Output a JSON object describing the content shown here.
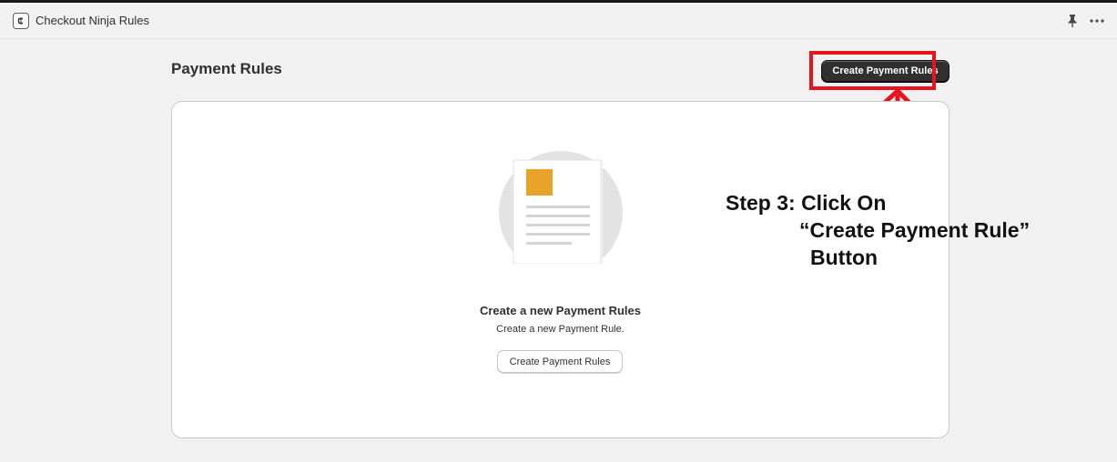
{
  "window": {
    "title": "Checkout Ninja Rules",
    "app_icon": "checkout-ninja-logo",
    "actions": [
      "pin-icon",
      "more-icon"
    ]
  },
  "page": {
    "title": "Payment Rules",
    "primary_action_label": "Create Payment Rules"
  },
  "empty_state": {
    "illustration": "document-icon",
    "heading": "Create a new Payment Rules",
    "description": "Create a new Payment Rule.",
    "button_label": "Create Payment Rules"
  },
  "annotation": {
    "line1": "Step 3: Click On",
    "line2": "“Create Payment Rule”",
    "line3": "Button",
    "color": "#e8141d"
  },
  "colors": {
    "background": "#f1f1f1",
    "primary_button": "#303030",
    "highlight": "#e8141d",
    "illustration_accent": "#e8a32a"
  }
}
